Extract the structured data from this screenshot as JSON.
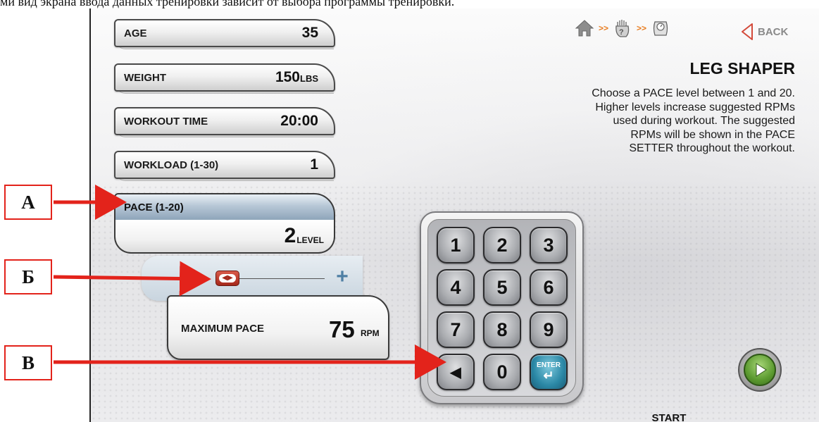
{
  "caption": "ми вид экрана ввода данных тренировки зависит от выбора программы тренировки.",
  "fields": [
    {
      "label": "AGE",
      "value": "35",
      "unit": ""
    },
    {
      "label": "WEIGHT",
      "value": "150",
      "unit": "LBS"
    },
    {
      "label": "WORKOUT TIME",
      "value": "20:00",
      "unit": ""
    },
    {
      "label": "WORKLOAD (1-30)",
      "value": "1",
      "unit": ""
    }
  ],
  "pace": {
    "label": "PACE (1-20)",
    "value": "2",
    "unit": "LEVEL",
    "level_fraction": 0.1
  },
  "max_pace": {
    "label": "MAXIMUM PACE",
    "value": "75",
    "unit": "RPM"
  },
  "keypad": {
    "keys": [
      "1",
      "2",
      "3",
      "4",
      "5",
      "6",
      "7",
      "8",
      "9",
      "◀",
      "0",
      "ENTER"
    ],
    "enter_label": "ENTER"
  },
  "nav": {
    "separator": ">>",
    "icons": [
      "home-icon",
      "workout-select-icon",
      "scale-icon"
    ],
    "back_label": "BACK"
  },
  "program": {
    "title": "LEG SHAPER",
    "description_lines": [
      "Choose a PACE level between 1 and 20.",
      "Higher levels increase suggested RPMs",
      "used during workout. The suggested",
      "RPMs will be shown in the PACE",
      "SETTER throughout the workout."
    ]
  },
  "start_label": "START",
  "markers": [
    "А",
    "Б",
    "В"
  ],
  "colors": {
    "annotation": "#e3231b",
    "enter_key": "#2b88a6",
    "start": "#5b9a2f",
    "slider_knob": "#c0392b",
    "nav_separator": "#e87c1e"
  }
}
